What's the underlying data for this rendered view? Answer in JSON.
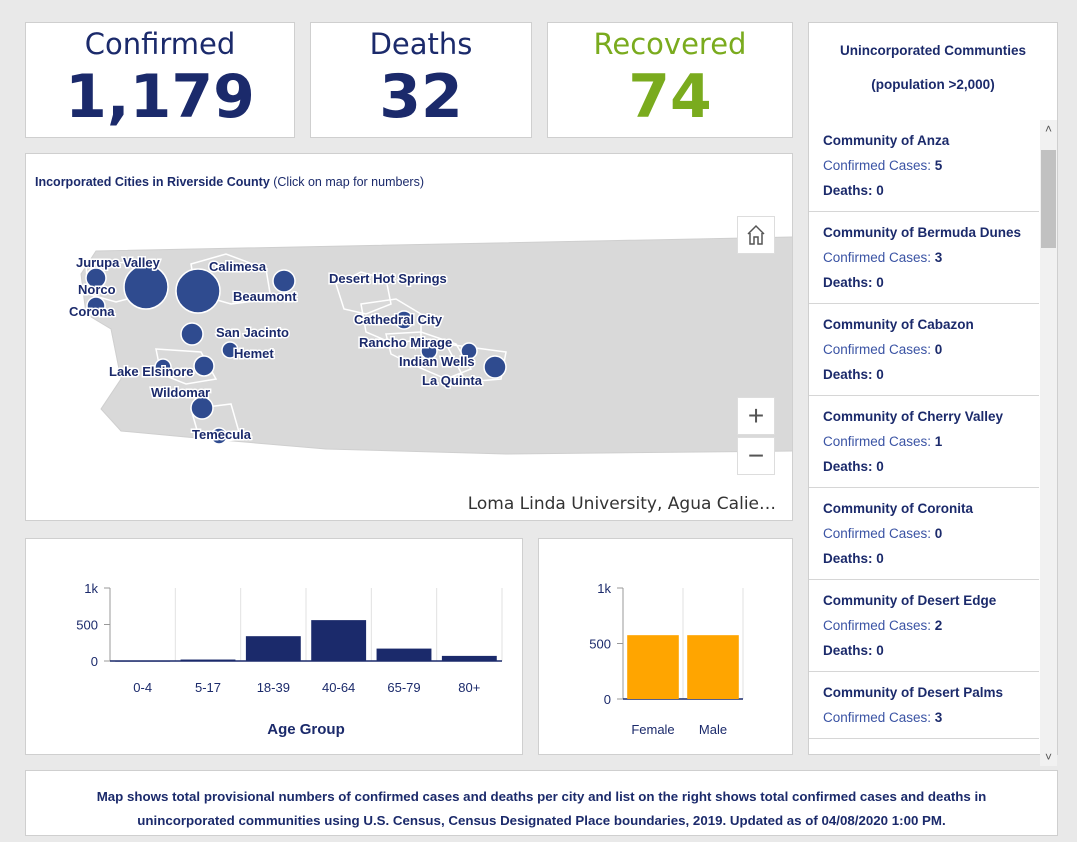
{
  "stats": {
    "confirmed": {
      "label": "Confirmed",
      "value": "1,179"
    },
    "deaths": {
      "label": "Deaths",
      "value": "32"
    },
    "recovered": {
      "label": "Recovered",
      "value": "74"
    }
  },
  "colors": {
    "navy": "#1b2a6b",
    "green": "#7aab1e",
    "orange": "#ffa500",
    "marker": "#2f4b8f",
    "land": "#d9d9d9"
  },
  "map": {
    "title_bold": "Incorporated Cities in Riverside County",
    "title_rest": " (Click on map for numbers)",
    "attribution": "Loma Linda University, Agua Calie…",
    "home_icon": "home-icon",
    "zoom_in": "+",
    "zoom_out": "−",
    "cities": [
      "Jurupa Valley",
      "Calimesa",
      "Norco",
      "Beaumont",
      "Corona",
      "Desert Hot Springs",
      "San Jacinto",
      "Hemet",
      "Cathedral City",
      "Rancho Mirage",
      "Indian Wells",
      "La Quinta",
      "Lake Elsinore",
      "Wildomar",
      "Temecula"
    ]
  },
  "unincorporated": {
    "title": "Unincorporated Communties",
    "subtitle": "(population >2,000)",
    "cases_label": "Confirmed Cases: ",
    "deaths_label": "Deaths: ",
    "items": [
      {
        "name": "Community of Anza",
        "cases": "5",
        "deaths": "0"
      },
      {
        "name": "Community of Bermuda Dunes",
        "cases": "3",
        "deaths": "0"
      },
      {
        "name": "Community of Cabazon",
        "cases": "0",
        "deaths": "0"
      },
      {
        "name": "Community of Cherry Valley",
        "cases": "1",
        "deaths": "0"
      },
      {
        "name": "Community of Coronita",
        "cases": "0",
        "deaths": "0"
      },
      {
        "name": "Community of Desert Edge",
        "cases": "2",
        "deaths": "0"
      },
      {
        "name": "Community of Desert Palms",
        "cases": "3",
        "deaths": ""
      }
    ]
  },
  "chart_data": [
    {
      "type": "bar",
      "categories": [
        "0-4",
        "5-17",
        "18-39",
        "40-64",
        "65-79",
        "80+"
      ],
      "values": [
        5,
        20,
        340,
        560,
        170,
        70
      ],
      "xlabel": "Age Group",
      "ylabel": "",
      "yticks": [
        "0",
        "500",
        "1k"
      ],
      "ylim": [
        0,
        1000
      ],
      "color": "#1b2a6b"
    },
    {
      "type": "bar",
      "categories": [
        "Female",
        "Male"
      ],
      "values": [
        575,
        575
      ],
      "xlabel": "",
      "ylabel": "",
      "yticks": [
        "0",
        "500",
        "1k"
      ],
      "ylim": [
        0,
        1000
      ],
      "color": "#ffa500"
    }
  ],
  "footer": {
    "text": "Map shows total provisional numbers of confirmed cases and deaths per city and list on the right shows total confirmed cases and deaths in unincorporated communities using U.S. Census, Census Designated Place boundaries, 2019. Updated as of 04/08/2020 1:00 PM."
  }
}
